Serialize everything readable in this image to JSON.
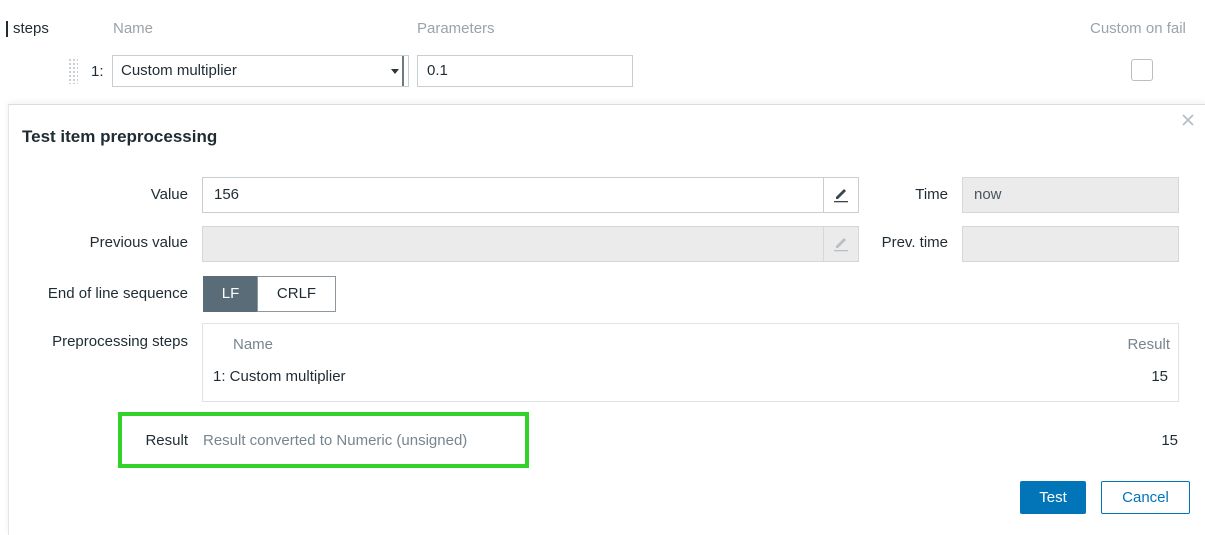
{
  "background_form": {
    "steps_label": "steps",
    "headers": {
      "name": "Name",
      "parameters": "Parameters",
      "custom_on_fail": "Custom on fail"
    },
    "step": {
      "number": "1:",
      "type": "Custom multiplier",
      "parameter": "0.1",
      "custom_on_fail_checked": false
    }
  },
  "modal": {
    "title": "Test item preprocessing",
    "close_icon": "close-icon",
    "value_label": "Value",
    "value": "156",
    "time_label": "Time",
    "time_value": "now",
    "previous_value_label": "Previous value",
    "previous_value": "",
    "prev_time_label": "Prev. time",
    "prev_time_value": "",
    "eol_label": "End of line sequence",
    "eol_options": [
      "LF",
      "CRLF"
    ],
    "eol_selected": "LF",
    "steps_label": "Preprocessing steps",
    "steps_table": {
      "headers": {
        "name": "Name",
        "result": "Result"
      },
      "rows": [
        {
          "name": "1: Custom multiplier",
          "result": "15"
        }
      ]
    },
    "result_label": "Result",
    "result_note": "Result converted to Numeric (unsigned)",
    "result_value": "15",
    "test_button": "Test",
    "cancel_button": "Cancel"
  },
  "colors": {
    "primary": "#0275b8",
    "segment_active": "#5a6c77",
    "highlight": "#35d12b",
    "disabled_bg": "#ebebeb"
  }
}
